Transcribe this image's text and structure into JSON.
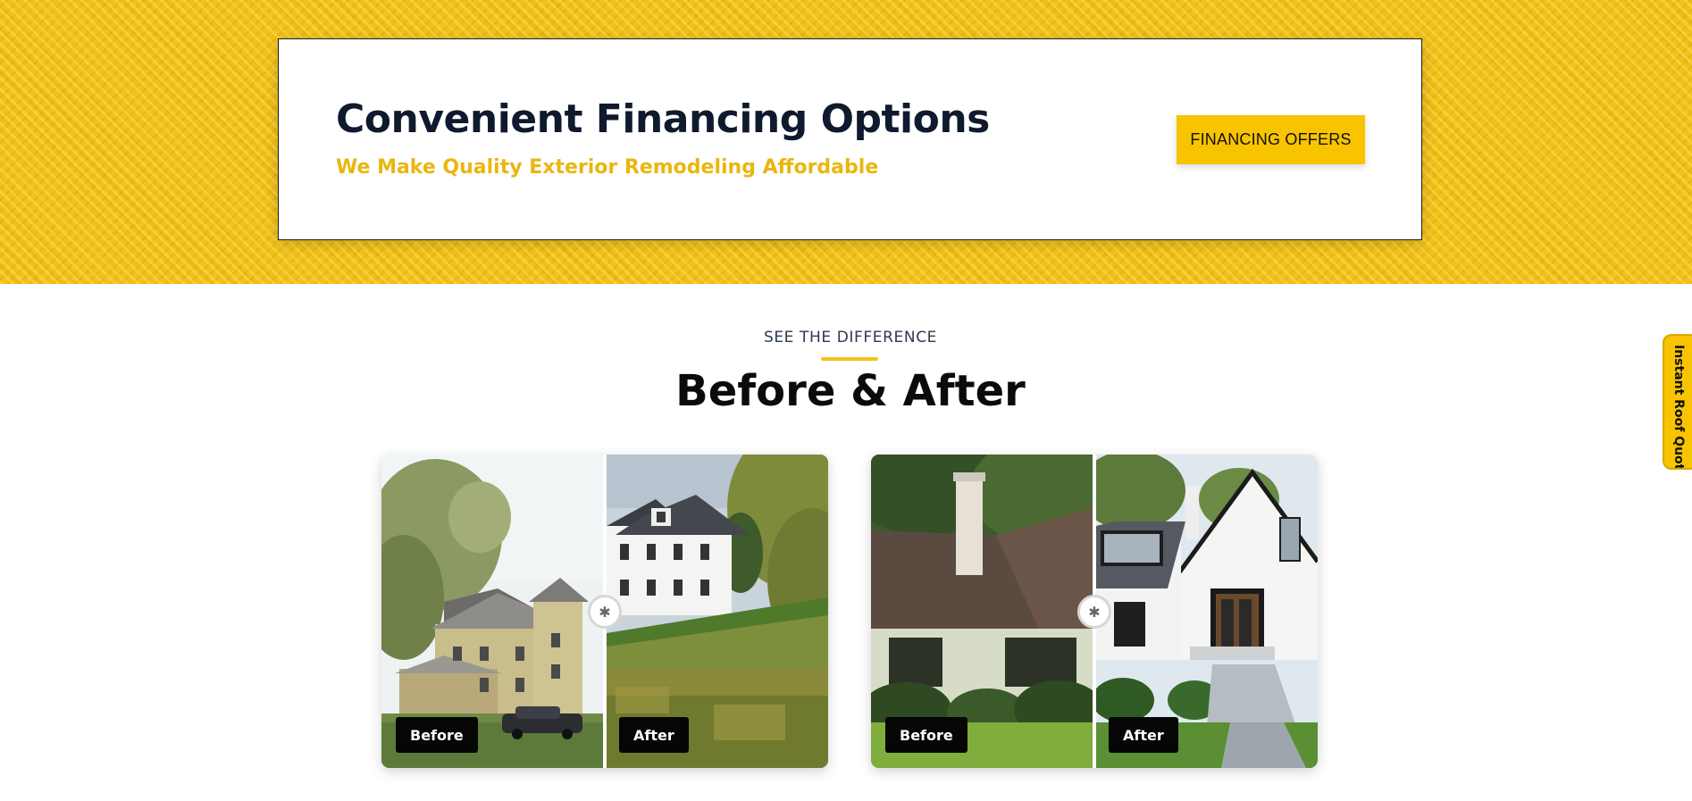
{
  "financing": {
    "title": "Convenient Financing Options",
    "subtitle": "We Make Quality Exterior Remodeling Affordable",
    "button_label": "FINANCING OFFERS"
  },
  "before_after": {
    "eyebrow": "SEE THE DIFFERENCE",
    "title": "Before & After",
    "comparisons": [
      {
        "before_label": "Before",
        "after_label": "After",
        "before_image": "run-down farmhouse with weathered siding and old car",
        "after_image": "restored white farmhouse with dark roof and meadow"
      },
      {
        "before_label": "Before",
        "after_label": "After",
        "before_image": "brown-roof house with chimney and shrubs",
        "after_image": "modern white house with black windows and stone walkway"
      }
    ]
  },
  "side_tab": {
    "label": "Instant Roof Quote"
  },
  "colors": {
    "accent_yellow": "#f3c21a",
    "button_yellow": "#f8c400",
    "heading_navy": "#101a2e",
    "subtitle_gold": "#eab60f"
  },
  "icons": {
    "slider_handle": "drag-handle-icon"
  }
}
